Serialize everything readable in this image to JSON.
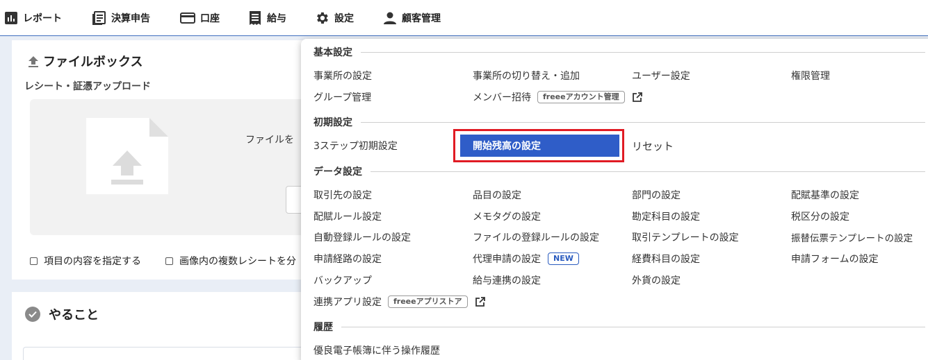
{
  "nav": {
    "report": "レポート",
    "tax": "決算申告",
    "account": "口座",
    "payroll": "給与",
    "settings": "設定",
    "customer": "顧客管理"
  },
  "filebox": {
    "title": "ファイルボックス",
    "subtitle": "レシート・証憑アップロード",
    "drop_text": "ファイルを",
    "checkbox1": "項目の内容を指定する",
    "checkbox2": "画像内の複数レシートを分"
  },
  "todo": {
    "title": "やること"
  },
  "menu": {
    "basic": {
      "heading": "基本設定",
      "office_settings": "事業所の設定",
      "office_switch": "事業所の切り替え・追加",
      "user_settings": "ユーザー設定",
      "permissions": "権限管理",
      "group": "グループ管理",
      "invite": "メンバー招待",
      "invite_tag": "freeeアカウント管理"
    },
    "initial": {
      "heading": "初期設定",
      "three_step": "3ステップ初期設定",
      "opening_balance": "開始残高の設定",
      "reset": "リセット"
    },
    "data": {
      "heading": "データ設定",
      "partners": "取引先の設定",
      "items": "品目の設定",
      "departments": "部門の設定",
      "allocation_basis": "配賦基準の設定",
      "allocation_rules": "配賦ルール設定",
      "memo_tags": "メモタグの設定",
      "account_items": "勘定科目の設定",
      "tax_categories": "税区分の設定",
      "auto_rules": "自動登録ルールの設定",
      "file_rules": "ファイルの登録ルールの設定",
      "deal_templates": "取引テンプレートの設定",
      "transfer_templates": "振替伝票テンプレートの設定",
      "approval_routes": "申請経路の設定",
      "proxy_requests": "代理申請の設定",
      "new_badge": "NEW",
      "expense_items": "経費科目の設定",
      "request_forms": "申請フォームの設定",
      "backup": "バックアップ",
      "payroll_link": "給与連携の設定",
      "foreign_currency": "外貨の設定",
      "apps": "連携アプリ設定",
      "apps_tag": "freeeアプリストア"
    },
    "history": {
      "heading": "履歴",
      "ebook_log": "優良電子帳簿に伴う操作履歴"
    }
  },
  "colors": {
    "accent": "#2f5dc8",
    "highlight_border": "#e01b24",
    "new_badge": "#2a5bbf"
  }
}
